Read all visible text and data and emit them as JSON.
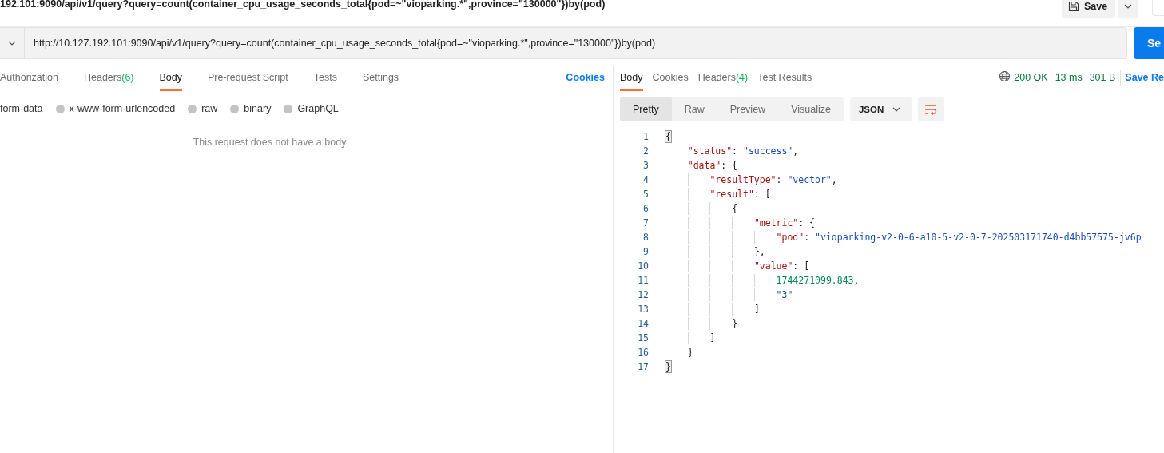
{
  "request_title": "192.101:9090/api/v1/query?query=count(container_cpu_usage_seconds_total{pod=~\"vioparking.*\",province=\"130000\"})by(pod)",
  "save_button": "Save",
  "url": "http://10.127.192.101:9090/api/v1/query?query=count(container_cpu_usage_seconds_total{pod=~\"vioparking.*\",province=\"130000\"})by(pod)",
  "send_button": "Se",
  "request_tabs": [
    {
      "label": "Authorization",
      "selected": false
    },
    {
      "label": "Headers",
      "count": "(6)",
      "selected": false
    },
    {
      "label": "Body",
      "selected": true
    },
    {
      "label": "Pre-request Script",
      "selected": false
    },
    {
      "label": "Tests",
      "selected": false
    },
    {
      "label": "Settings",
      "selected": false
    }
  ],
  "cookies_link": "Cookies",
  "body_types": [
    {
      "label": "form-data"
    },
    {
      "label": "x-www-form-urlencoded"
    },
    {
      "label": "raw"
    },
    {
      "label": "binary"
    },
    {
      "label": "GraphQL"
    }
  ],
  "empty_body_message": "This request does not have a body",
  "response_tabs": [
    {
      "label": "Body",
      "selected": true
    },
    {
      "label": "Cookies",
      "selected": false
    },
    {
      "label": "Headers",
      "count": "(4)",
      "selected": false
    },
    {
      "label": "Test Results",
      "selected": false
    }
  ],
  "status": "200 OK",
  "time": "13 ms",
  "size": "301 B",
  "save_response": "Save Re",
  "view_modes": [
    {
      "label": "Pretty",
      "selected": true
    },
    {
      "label": "Raw",
      "selected": false
    },
    {
      "label": "Preview",
      "selected": false
    },
    {
      "label": "Visualize",
      "selected": false
    }
  ],
  "format": "JSON",
  "code_lines": [
    {
      "number": "1",
      "tokens": [
        {
          "kind": "punct",
          "text": "{",
          "matched": true
        }
      ],
      "children": [
        {
          "number": "2",
          "tokens": [
            {
              "kind": "key",
              "text": "\"status\""
            },
            {
              "kind": "punct",
              "text": ": "
            },
            {
              "kind": "string",
              "text": "\"success\""
            },
            {
              "kind": "punct",
              "text": ","
            }
          ]
        },
        {
          "number": "3",
          "tokens": [
            {
              "kind": "key",
              "text": "\"data\""
            },
            {
              "kind": "punct",
              "text": ": {"
            }
          ],
          "children": [
            {
              "number": "4",
              "tokens": [
                {
                  "kind": "key",
                  "text": "\"resultType\""
                },
                {
                  "kind": "punct",
                  "text": ": "
                },
                {
                  "kind": "string",
                  "text": "\"vector\""
                },
                {
                  "kind": "punct",
                  "text": ","
                }
              ]
            },
            {
              "number": "5",
              "tokens": [
                {
                  "kind": "key",
                  "text": "\"result\""
                },
                {
                  "kind": "punct",
                  "text": ": ["
                }
              ],
              "children": [
                {
                  "number": "6",
                  "tokens": [
                    {
                      "kind": "punct",
                      "text": "{"
                    }
                  ],
                  "children": [
                    {
                      "number": "7",
                      "tokens": [
                        {
                          "kind": "key",
                          "text": "\"metric\""
                        },
                        {
                          "kind": "punct",
                          "text": ": {"
                        }
                      ],
                      "children": [
                        {
                          "number": "8",
                          "tokens": [
                            {
                              "kind": "key",
                              "text": "\"pod\""
                            },
                            {
                              "kind": "punct",
                              "text": ": "
                            },
                            {
                              "kind": "string",
                              "text": "\"vioparking-v2-0-6-a10-5-v2-0-7-202503171740-d4bb57575-jv6p"
                            }
                          ]
                        }
                      ]
                    },
                    {
                      "number": "9",
                      "tokens": [
                        {
                          "kind": "punct",
                          "text": "},"
                        }
                      ]
                    },
                    {
                      "number": "10",
                      "tokens": [
                        {
                          "kind": "key",
                          "text": "\"value\""
                        },
                        {
                          "kind": "punct",
                          "text": ": ["
                        }
                      ],
                      "children": [
                        {
                          "number": "11",
                          "tokens": [
                            {
                              "kind": "number",
                              "text": "1744271099.843"
                            },
                            {
                              "kind": "punct",
                              "text": ","
                            }
                          ]
                        },
                        {
                          "number": "12",
                          "tokens": [
                            {
                              "kind": "string",
                              "text": "\"3\""
                            }
                          ]
                        }
                      ]
                    },
                    {
                      "number": "13",
                      "tokens": [
                        {
                          "kind": "punct",
                          "text": "]"
                        }
                      ]
                    }
                  ]
                },
                {
                  "number": "14",
                  "tokens": [
                    {
                      "kind": "punct",
                      "text": "}"
                    }
                  ]
                }
              ]
            },
            {
              "number": "15",
              "tokens": [
                {
                  "kind": "punct",
                  "text": "]"
                }
              ]
            }
          ]
        },
        {
          "number": "16",
          "tokens": [
            {
              "kind": "punct",
              "text": "}"
            }
          ]
        }
      ]
    },
    {
      "number": "17",
      "tokens": [
        {
          "kind": "punct",
          "text": "}",
          "matched": true
        }
      ]
    }
  ]
}
